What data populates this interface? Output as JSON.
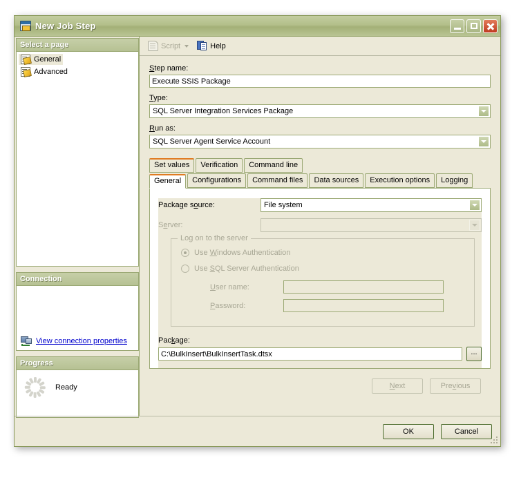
{
  "window": {
    "title": "New Job Step",
    "icon": "job-step-icon",
    "buttons": {
      "minimize": "minimize",
      "maximize": "maximize",
      "close": "close"
    }
  },
  "sidebar": {
    "pages_header": "Select a page",
    "pages": [
      {
        "label": "General",
        "icon": "page-icon",
        "selected": true
      },
      {
        "label": "Advanced",
        "icon": "page-icon",
        "selected": false
      }
    ],
    "connection_header": "Connection",
    "connection_link": "View connection properties",
    "progress_header": "Progress",
    "progress_status": "Ready"
  },
  "toolbar": {
    "script_label": "Script",
    "script_enabled": false,
    "help_label": "Help"
  },
  "form": {
    "step_name_label": "Step name:",
    "step_name_mnemonic": "S",
    "step_name_value": "Execute SSIS Package",
    "type_label": "Type:",
    "type_mnemonic": "T",
    "type_value": "SQL Server Integration Services Package",
    "run_as_label": "Run as:",
    "run_as_mnemonic": "R",
    "run_as_value": "SQL Server Agent Service Account"
  },
  "tabs": {
    "top_row": [
      {
        "label": "Set values",
        "active": true
      },
      {
        "label": "Verification",
        "active": false
      },
      {
        "label": "Command line",
        "active": false
      }
    ],
    "bottom_row": [
      {
        "label": "General",
        "active": true
      },
      {
        "label": "Configurations",
        "active": false
      },
      {
        "label": "Command files",
        "active": false
      },
      {
        "label": "Data sources",
        "active": false
      },
      {
        "label": "Execution options",
        "active": false
      },
      {
        "label": "Logging",
        "active": false
      }
    ]
  },
  "general_tab": {
    "package_source_label": "Package source:",
    "package_source_value": "File system",
    "server_label": "Server:",
    "server_value": "",
    "server_enabled": false,
    "logon_group_title": "Log on to the server",
    "windows_auth_label": "Use Windows Authentication",
    "windows_auth_checked": true,
    "sql_auth_label": "Use SQL Server Authentication",
    "sql_auth_checked": false,
    "user_name_label": "User name:",
    "user_name_value": "",
    "password_label": "Password:",
    "password_value": "",
    "package_label": "Package:",
    "package_value": "C:\\BulkInsert\\BulkInsertTask.dtsx",
    "browse_label": "..."
  },
  "navigation": {
    "next_label": "Next",
    "next_enabled": false,
    "previous_label": "Previous",
    "previous_enabled": false
  },
  "footer": {
    "ok_label": "OK",
    "cancel_label": "Cancel"
  },
  "colors": {
    "titlebar": "#b3bf8a",
    "dialog_bg": "#ece9d8",
    "border": "#9aa873",
    "accent_tab": "#e07b22",
    "link": "#0000cd",
    "close_button": "#c03a20",
    "disabled_text": "#a8a795"
  }
}
